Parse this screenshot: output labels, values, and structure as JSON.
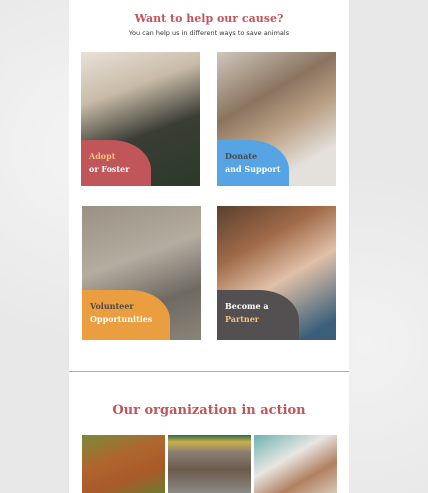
{
  "help": {
    "title": "Want to help our cause?",
    "subtitle": "You can help us in different ways to save animals"
  },
  "cards": [
    {
      "line1": "Adopt",
      "line2": "or Foster",
      "color": "#c0555a",
      "line1_color": "#f6c07a",
      "line2_color": "#ffffff"
    },
    {
      "line1": "Donate",
      "line2": "and Support",
      "color": "#57a4e4",
      "line1_color": "#4a4a4a",
      "line2_color": "#ffffff"
    },
    {
      "line1": "Volunteer",
      "line2": "Opportunities",
      "color": "#eb9e40",
      "line1_color": "#4a4a4a",
      "line2_color": "#ffffff"
    },
    {
      "line1": "Become a",
      "line2": "Partner",
      "color": "#545051",
      "line1_color": "#ffffff",
      "line2_color": "#f6c07a"
    }
  ],
  "action": {
    "title": "Our organization in action"
  }
}
